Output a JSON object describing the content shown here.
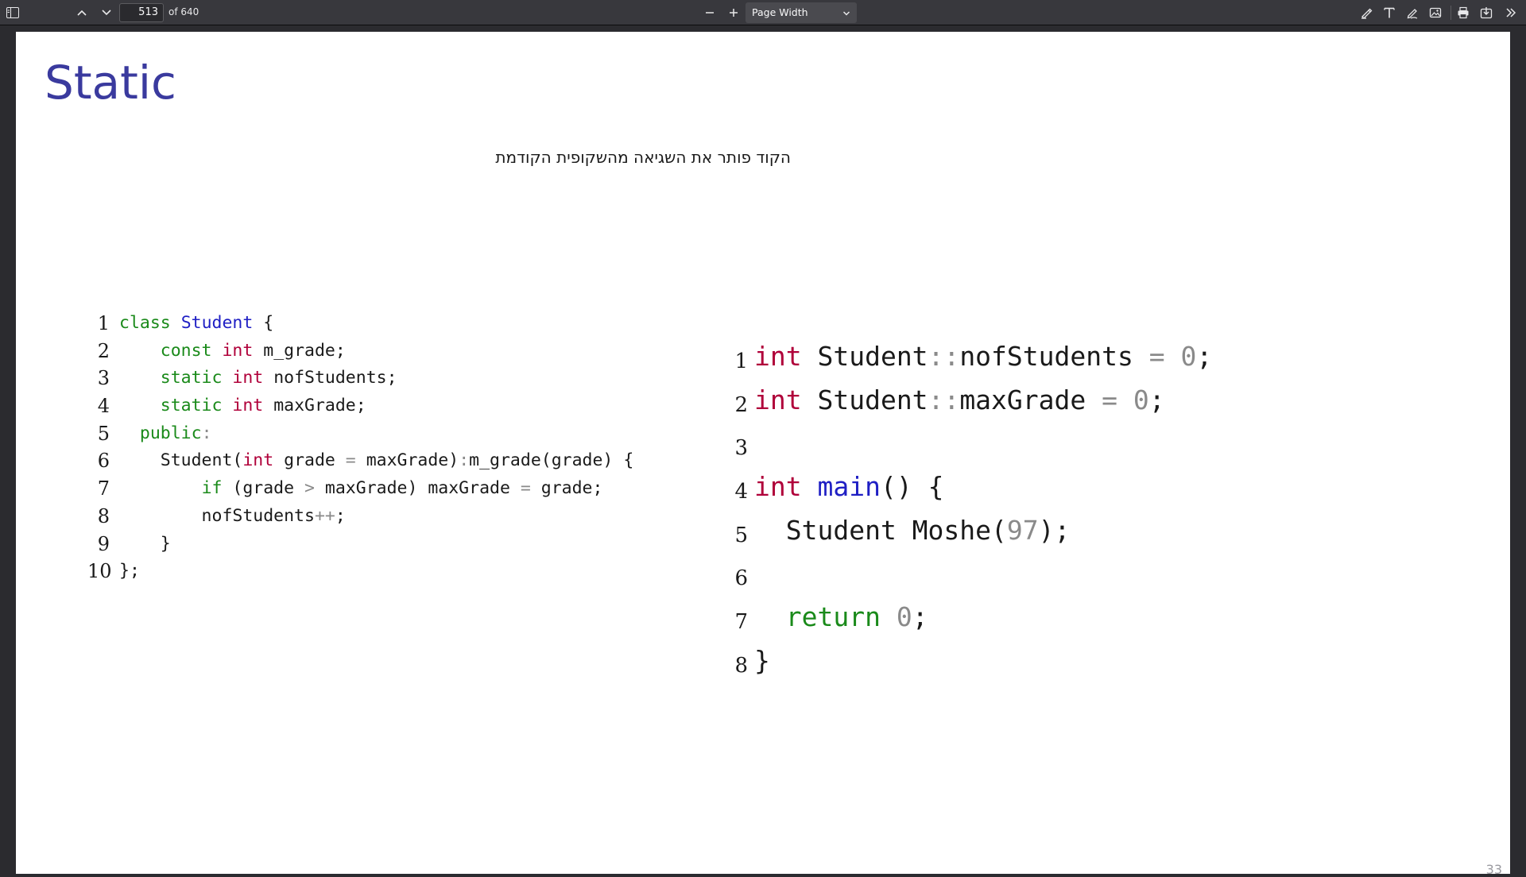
{
  "toolbar": {
    "page_number": "513",
    "page_total": "of 640",
    "zoom_value": "Page Width",
    "icons": [
      "sidebar-toggle-icon",
      "chevron-up-icon",
      "chevron-down-icon",
      "zoom-out-icon",
      "zoom-in-icon",
      "highlight-icon",
      "text-icon",
      "draw-icon",
      "image-icon",
      "print-icon",
      "save-icon",
      "tools-icon"
    ]
  },
  "slide": {
    "title": "Static",
    "subtitle": "הקוד פותר את השגיאה מהשקופית הקודמת",
    "page_number": "33",
    "accent_color": "#3a3a9e"
  },
  "code_left": [
    {
      "n": "1",
      "tokens": [
        {
          "t": "class",
          "c": "green"
        },
        {
          "t": " "
        },
        {
          "t": "Student",
          "c": "class"
        },
        {
          "t": " {"
        }
      ]
    },
    {
      "n": "2",
      "tokens": [
        {
          "t": "    "
        },
        {
          "t": "const",
          "c": "green"
        },
        {
          "t": " "
        },
        {
          "t": "int",
          "c": "type"
        },
        {
          "t": " m_grade;"
        }
      ]
    },
    {
      "n": "3",
      "tokens": [
        {
          "t": "    "
        },
        {
          "t": "static",
          "c": "green"
        },
        {
          "t": " "
        },
        {
          "t": "int",
          "c": "type"
        },
        {
          "t": " nofStudents;"
        }
      ]
    },
    {
      "n": "4",
      "tokens": [
        {
          "t": "    "
        },
        {
          "t": "static",
          "c": "green"
        },
        {
          "t": " "
        },
        {
          "t": "int",
          "c": "type"
        },
        {
          "t": " maxGrade;"
        }
      ]
    },
    {
      "n": "5",
      "tokens": [
        {
          "t": "  "
        },
        {
          "t": "public",
          "c": "green"
        },
        {
          "t": ":",
          "c": "op"
        }
      ]
    },
    {
      "n": "6",
      "tokens": [
        {
          "t": "    Student("
        },
        {
          "t": "int",
          "c": "type"
        },
        {
          "t": " grade "
        },
        {
          "t": "=",
          "c": "op"
        },
        {
          "t": " maxGrade)"
        },
        {
          "t": ":",
          "c": "op"
        },
        {
          "t": "m_grade(grade) {"
        }
      ]
    },
    {
      "n": "7",
      "tokens": [
        {
          "t": "        "
        },
        {
          "t": "if",
          "c": "green"
        },
        {
          "t": " (grade "
        },
        {
          "t": ">",
          "c": "op"
        },
        {
          "t": " maxGrade) maxGrade "
        },
        {
          "t": "=",
          "c": "op"
        },
        {
          "t": " grade;"
        }
      ]
    },
    {
      "n": "8",
      "tokens": [
        {
          "t": "        nofStudents"
        },
        {
          "t": "++",
          "c": "op"
        },
        {
          "t": ";"
        }
      ]
    },
    {
      "n": "9",
      "tokens": [
        {
          "t": "    }"
        }
      ]
    },
    {
      "n": "10",
      "tokens": [
        {
          "t": "};"
        }
      ]
    }
  ],
  "code_right": [
    {
      "n": "1",
      "tokens": [
        {
          "t": "int",
          "c": "type"
        },
        {
          "t": " Student"
        },
        {
          "t": "::",
          "c": "op"
        },
        {
          "t": "nofStudents "
        },
        {
          "t": "=",
          "c": "op"
        },
        {
          "t": " "
        },
        {
          "t": "0",
          "c": "op"
        },
        {
          "t": ";"
        }
      ]
    },
    {
      "n": "2",
      "tokens": [
        {
          "t": "int",
          "c": "type"
        },
        {
          "t": " Student"
        },
        {
          "t": "::",
          "c": "op"
        },
        {
          "t": "maxGrade "
        },
        {
          "t": "=",
          "c": "op"
        },
        {
          "t": " "
        },
        {
          "t": "0",
          "c": "op"
        },
        {
          "t": ";"
        }
      ]
    },
    {
      "n": "3",
      "tokens": []
    },
    {
      "n": "4",
      "tokens": [
        {
          "t": "int",
          "c": "type"
        },
        {
          "t": " "
        },
        {
          "t": "main",
          "c": "class"
        },
        {
          "t": "() {"
        }
      ]
    },
    {
      "n": "5",
      "tokens": [
        {
          "t": "  Student Moshe("
        },
        {
          "t": "97",
          "c": "op"
        },
        {
          "t": ");"
        }
      ]
    },
    {
      "n": "6",
      "tokens": []
    },
    {
      "n": "7",
      "tokens": [
        {
          "t": "  "
        },
        {
          "t": "return",
          "c": "green"
        },
        {
          "t": " "
        },
        {
          "t": "0",
          "c": "op"
        },
        {
          "t": ";"
        }
      ]
    },
    {
      "n": "8",
      "tokens": [
        {
          "t": "}"
        }
      ]
    }
  ]
}
